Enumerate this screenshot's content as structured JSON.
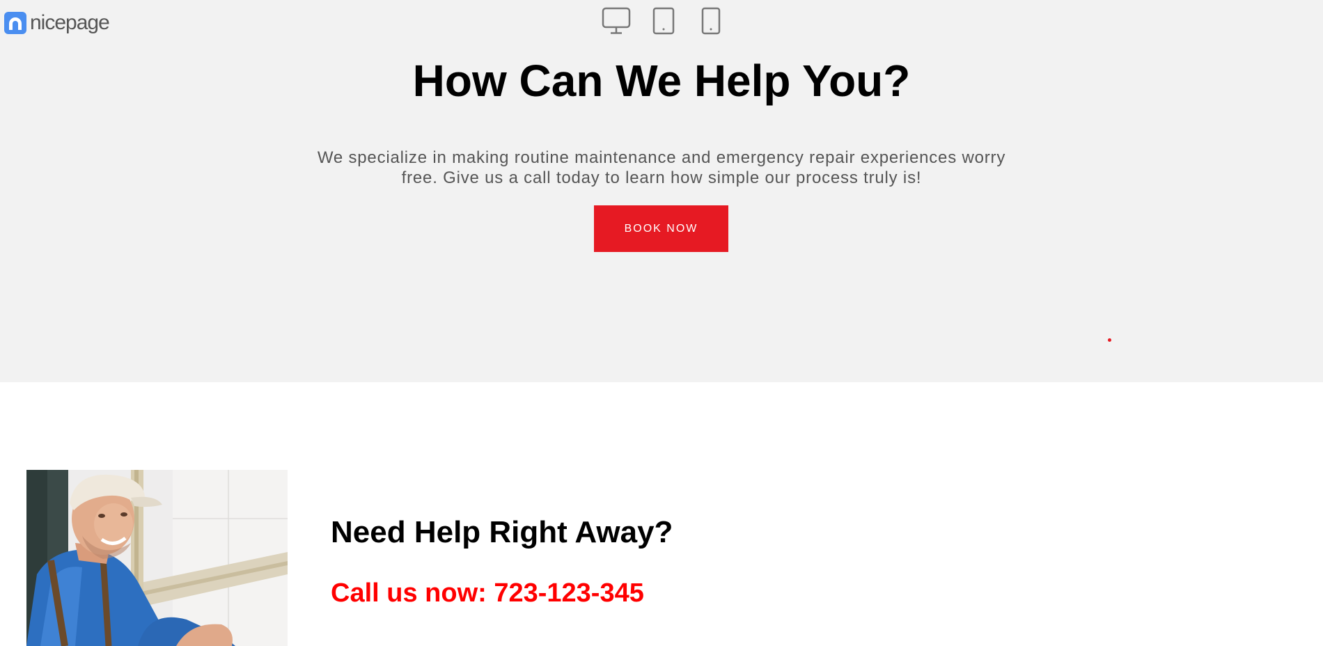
{
  "brand": {
    "name": "nicepage",
    "icon": "nicepage-logo-icon",
    "color": "#4a8ef0"
  },
  "device_switcher": {
    "icons": [
      "desktop-icon",
      "tablet-icon",
      "phone-icon"
    ]
  },
  "hero": {
    "title": "How Can We Help You?",
    "description": "We specialize in making routine maintenance and emergency repair experiences worry free. Give us a call today to learn how simple our process truly is!",
    "button_label": "BOOK NOW",
    "background": "#f2f2f2",
    "accent": "#e61a23"
  },
  "help": {
    "title": "Need Help Right Away?",
    "call_text": "Call us now: 723-123-345",
    "call_color": "#ff0000",
    "photo": "smiling-repair-worker-photo"
  }
}
